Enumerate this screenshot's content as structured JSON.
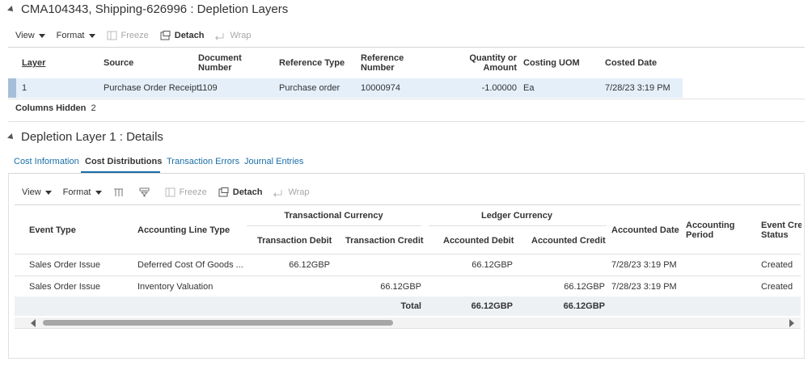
{
  "depletion_layers": {
    "title": "CMA104343, Shipping-626996 : Depletion Layers",
    "toolbar": {
      "view": "View",
      "format": "Format",
      "freeze": "Freeze",
      "detach": "Detach",
      "wrap": "Wrap"
    },
    "columns": {
      "layer": "Layer",
      "source": "Source",
      "document_number_1": "Document",
      "document_number_2": "Number",
      "reference_type": "Reference Type",
      "reference_number_1": "Reference",
      "reference_number_2": "Number",
      "quantity_1": "Quantity or",
      "quantity_2": "Amount",
      "costing_uom": "Costing UOM",
      "costed_date": "Costed Date"
    },
    "rows": [
      {
        "layer": "1",
        "source": "Purchase Order Receipt",
        "document_number": "1109",
        "reference_type": "Purchase order",
        "reference_number": "10000974",
        "quantity": "-1.00000",
        "costing_uom": "Ea",
        "costed_date": "7/28/23 3:19 PM"
      }
    ],
    "columns_hidden_label": "Columns Hidden",
    "columns_hidden_count": "2"
  },
  "details": {
    "title": "Depletion Layer 1 : Details",
    "tabs": [
      {
        "label": "Cost Information"
      },
      {
        "label": "Cost Distributions"
      },
      {
        "label": "Transaction Errors"
      },
      {
        "label": "Journal Entries"
      }
    ],
    "active_tab": "Cost Distributions",
    "toolbar": {
      "view": "View",
      "format": "Format",
      "freeze": "Freeze",
      "detach": "Detach",
      "wrap": "Wrap"
    },
    "columns": {
      "event_type": "Event Type",
      "accounting_line_type": "Accounting Line Type",
      "transactional_currency": "Transactional Currency",
      "transaction_debit": "Transaction Debit",
      "transaction_credit": "Transaction Credit",
      "ledger_currency": "Ledger Currency",
      "accounted_debit": "Accounted Debit",
      "accounted_credit": "Accounted Credit",
      "accounted_date": "Accounted Date",
      "accounting_period_1": "Accounting",
      "accounting_period_2": "Period",
      "event_status_1": "Event Cre",
      "event_status_2": "Status"
    },
    "rows": [
      {
        "event_type": "Sales Order Issue",
        "accounting_line_type": "Deferred Cost Of Goods ...",
        "transaction_debit": "66.12GBP",
        "transaction_credit": "",
        "accounted_debit": "66.12GBP",
        "accounted_credit": "",
        "accounted_date": "7/28/23 3:19 PM",
        "accounting_period": "",
        "event_status": "Created"
      },
      {
        "event_type": "Sales Order Issue",
        "accounting_line_type": "Inventory Valuation",
        "transaction_debit": "",
        "transaction_credit": "66.12GBP",
        "accounted_debit": "",
        "accounted_credit": "66.12GBP",
        "accounted_date": "7/28/23 3:19 PM",
        "accounting_period": "",
        "event_status": "Created"
      }
    ],
    "total_label": "Total",
    "total_accounted_debit": "66.12GBP",
    "total_accounted_credit": "66.12GBP"
  },
  "colors": {
    "link": "#1a6ea8",
    "selected_row": "#e4effa",
    "total_row": "#eef1f4"
  }
}
